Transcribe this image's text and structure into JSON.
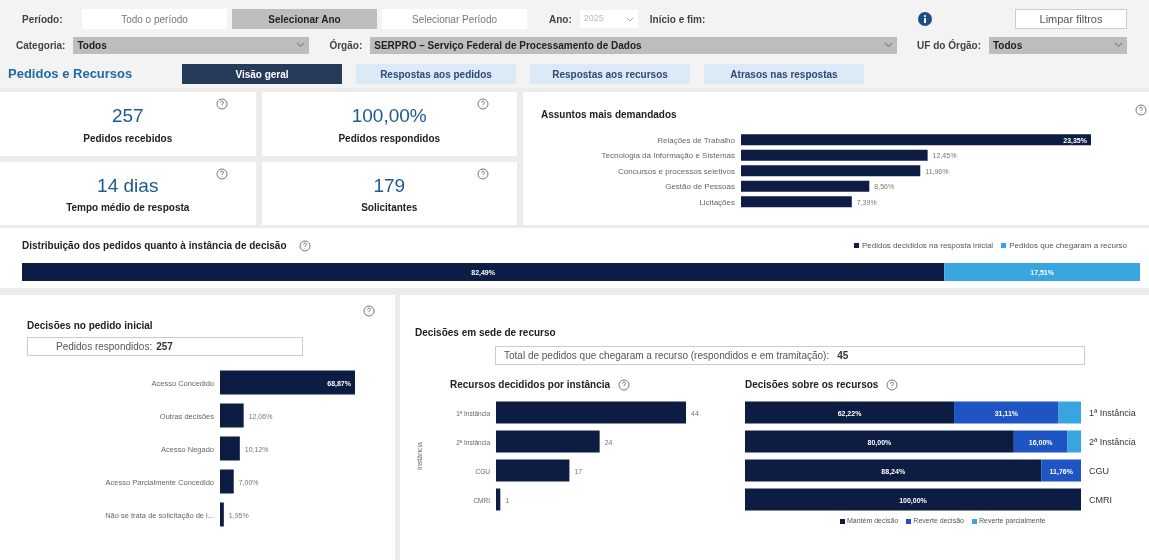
{
  "filters": {
    "period_label": "Período:",
    "period_options": [
      {
        "label": "Todo o período",
        "selected": false
      },
      {
        "label": "Selecionar Ano",
        "selected": true
      },
      {
        "label": "Selecionar Período",
        "selected": false
      }
    ],
    "year_label": "Ano:",
    "year_value": "2025",
    "range_label": "Início e fim:",
    "clear_button": "Limpar filtros",
    "category": {
      "label": "Categoria:",
      "value": "Todos"
    },
    "organ": {
      "label": "Órgão:",
      "value": "SERPRO – Serviço Federal de Processamento de Dados"
    },
    "uf": {
      "label": "UF do Órgão:",
      "value": "Todos"
    }
  },
  "section_title": "Pedidos e Recursos",
  "tabs": [
    {
      "label": "Visão geral",
      "selected": true
    },
    {
      "label": "Respostas aos pedidos",
      "selected": false
    },
    {
      "label": "Respostas aos recursos",
      "selected": false
    },
    {
      "label": "Atrasos nas respostas",
      "selected": false
    }
  ],
  "kpis": [
    {
      "value": "257",
      "label": "Pedidos recebidos"
    },
    {
      "value": "100,00%",
      "label": "Pedidos respondidos"
    },
    {
      "value": "14 dias",
      "label": "Tempo médio de resposta"
    },
    {
      "value": "179",
      "label": "Solicitantes"
    }
  ],
  "subjects": {
    "title": "Assuntos mais demandados",
    "chart_data": {
      "type": "bar",
      "orientation": "horizontal",
      "categories": [
        "Relações de Trabalho",
        "Tecnologia da Informação e Sistemas",
        "Concursos e processos seletivos",
        "Gestão de Pessoas",
        "Licitações"
      ],
      "values": [
        23.35,
        12.45,
        11.96,
        8.56,
        7.39
      ],
      "value_labels": [
        "23,35%",
        "12,45%",
        "11,96%",
        "8,56%",
        "7,39%"
      ]
    }
  },
  "distribution": {
    "title": "Distribuição dos pedidos quanto à instância de decisão",
    "chart_data": {
      "type": "bar",
      "orientation": "horizontal",
      "stacked": true,
      "series": [
        {
          "name": "Pedidos decididos na resposta inicial",
          "color": "#0c1c42",
          "values": [
            82.49
          ],
          "value_labels": [
            "82,49%"
          ]
        },
        {
          "name": "Pedidos que chegaram a recurso",
          "color": "#36a5e0",
          "values": [
            17.51
          ],
          "value_labels": [
            "17,51%"
          ]
        }
      ]
    }
  },
  "initial_decisions": {
    "title": "Decisões no pedido inicial",
    "summary_label": "Pedidos respondidos:",
    "summary_value": "257",
    "chart_data": {
      "type": "bar",
      "orientation": "horizontal",
      "categories": [
        "Acesso Concedido",
        "Outras decisões",
        "Acesso Negado",
        "Acesso Parcialmente Concedido",
        "Não se trata de solicitação de i..."
      ],
      "values": [
        68.87,
        12.06,
        10.12,
        7.0,
        1.95
      ],
      "value_labels": [
        "68,87%",
        "12,06%",
        "10,12%",
        "7,00%",
        "1,95%"
      ]
    }
  },
  "appeals": {
    "title": "Decisões em sede de recurso",
    "summary_label": "Total de pedidos que chegaram a recurso (respondidos e em tramitação):",
    "summary_value": "45",
    "by_instance": {
      "title": "Recursos decididos por instância",
      "chart_data": {
        "type": "bar",
        "orientation": "horizontal",
        "ylabel": "Instância",
        "categories": [
          "1ª Instância",
          "2ª Instância",
          "CGU",
          "CMRI"
        ],
        "values": [
          44,
          24,
          17,
          1
        ],
        "value_labels": [
          "44",
          "24",
          "17",
          "1"
        ]
      }
    },
    "decisions": {
      "title": "Decisões sobre os recursos",
      "chart_data": {
        "type": "bar",
        "orientation": "horizontal",
        "stacked": true,
        "categories": [
          "1ª Instância",
          "2ª Instância",
          "CGU",
          "CMRI"
        ],
        "series": [
          {
            "name": "Mantém decisão",
            "color": "#0c1c42",
            "values": [
              62.22,
              80.0,
              88.24,
              100.0
            ],
            "value_labels": [
              "62,22%",
              "80,00%",
              "88,24%",
              "100,00%"
            ]
          },
          {
            "name": "Reverte decisão",
            "color": "#1f54c4",
            "values": [
              31.11,
              16.0,
              11.76,
              0
            ],
            "value_labels": [
              "31,11%",
              "16,00%",
              "11,76%",
              null
            ]
          },
          {
            "name": "Reverte parcialmente",
            "color": "#36a5e0",
            "values": [
              6.67,
              4.0,
              0,
              0
            ],
            "value_labels": [
              null,
              null,
              null,
              null
            ]
          }
        ]
      }
    }
  }
}
